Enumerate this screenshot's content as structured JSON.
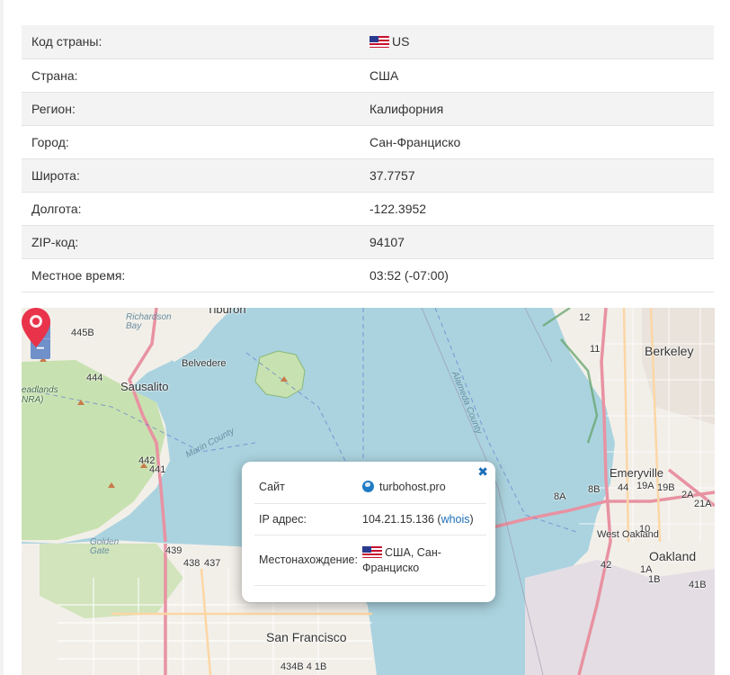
{
  "info_table": {
    "rows": [
      {
        "label": "Код страны:",
        "value": "US"
      },
      {
        "label": "Страна:",
        "value": "США"
      },
      {
        "label": "Регион:",
        "value": "Калифорния"
      },
      {
        "label": "Город:",
        "value": "Сан-Франциско"
      },
      {
        "label": "Широта:",
        "value": "37.7757"
      },
      {
        "label": "Долгота:",
        "value": "-122.3952"
      },
      {
        "label": "ZIP-код:",
        "value": "94107"
      },
      {
        "label": "Местное время:",
        "value": "03:52 (-07:00)"
      }
    ]
  },
  "map": {
    "zoom_in": "+",
    "zoom_out": "−",
    "labels": {
      "tiburon": "Tiburon",
      "richardson_bay": "Richardson Bay",
      "belvedere": "Belvedere",
      "sausalito": "Sausalito",
      "headlands": "eadlands NRA)",
      "berkeley": "Berkeley",
      "emeryville": "Emeryville",
      "west_oakland": "West Oakland",
      "oakland": "Oakland",
      "golden_gate": "Golden Gate",
      "san_francisco": "San Francisco",
      "marin_county": "Marin County",
      "alameda_county": "Alameda County",
      "route_445b": "445B",
      "route_444": "444",
      "route_442": "442",
      "route_441": "441",
      "route_439": "439",
      "route_438": "438",
      "route_437": "437",
      "route_8a": "8A",
      "route_8b": "8B",
      "route_44": "44",
      "route_19a": "19A",
      "route_19b": "19B",
      "route_2a": "2A",
      "route_21a": "21A",
      "route_10": "10",
      "route_1a": "1A",
      "route_1b": "1B",
      "route_41b": "41B",
      "route_42": "42",
      "route_434b": "434B 4 1B",
      "route_12": "12",
      "route_11": "11"
    },
    "popup": {
      "close": "✖",
      "site_label": "Сайт",
      "site_value": "turbohost.pro",
      "ip_label": "IP адрес:",
      "ip_value": "104.21.15.136 (",
      "whois": "whois",
      "ip_close": ")",
      "location_label": "Местонахождение:",
      "location_value": "США, Сан-Франциско"
    }
  },
  "colors": {
    "water": "#aad3df",
    "land": "#f2efe9",
    "park": "#c8e1b0",
    "motorway": "#e892a2",
    "primary": "#fcd6a4",
    "marker": "#e8334a",
    "link": "#1d6fb8"
  }
}
